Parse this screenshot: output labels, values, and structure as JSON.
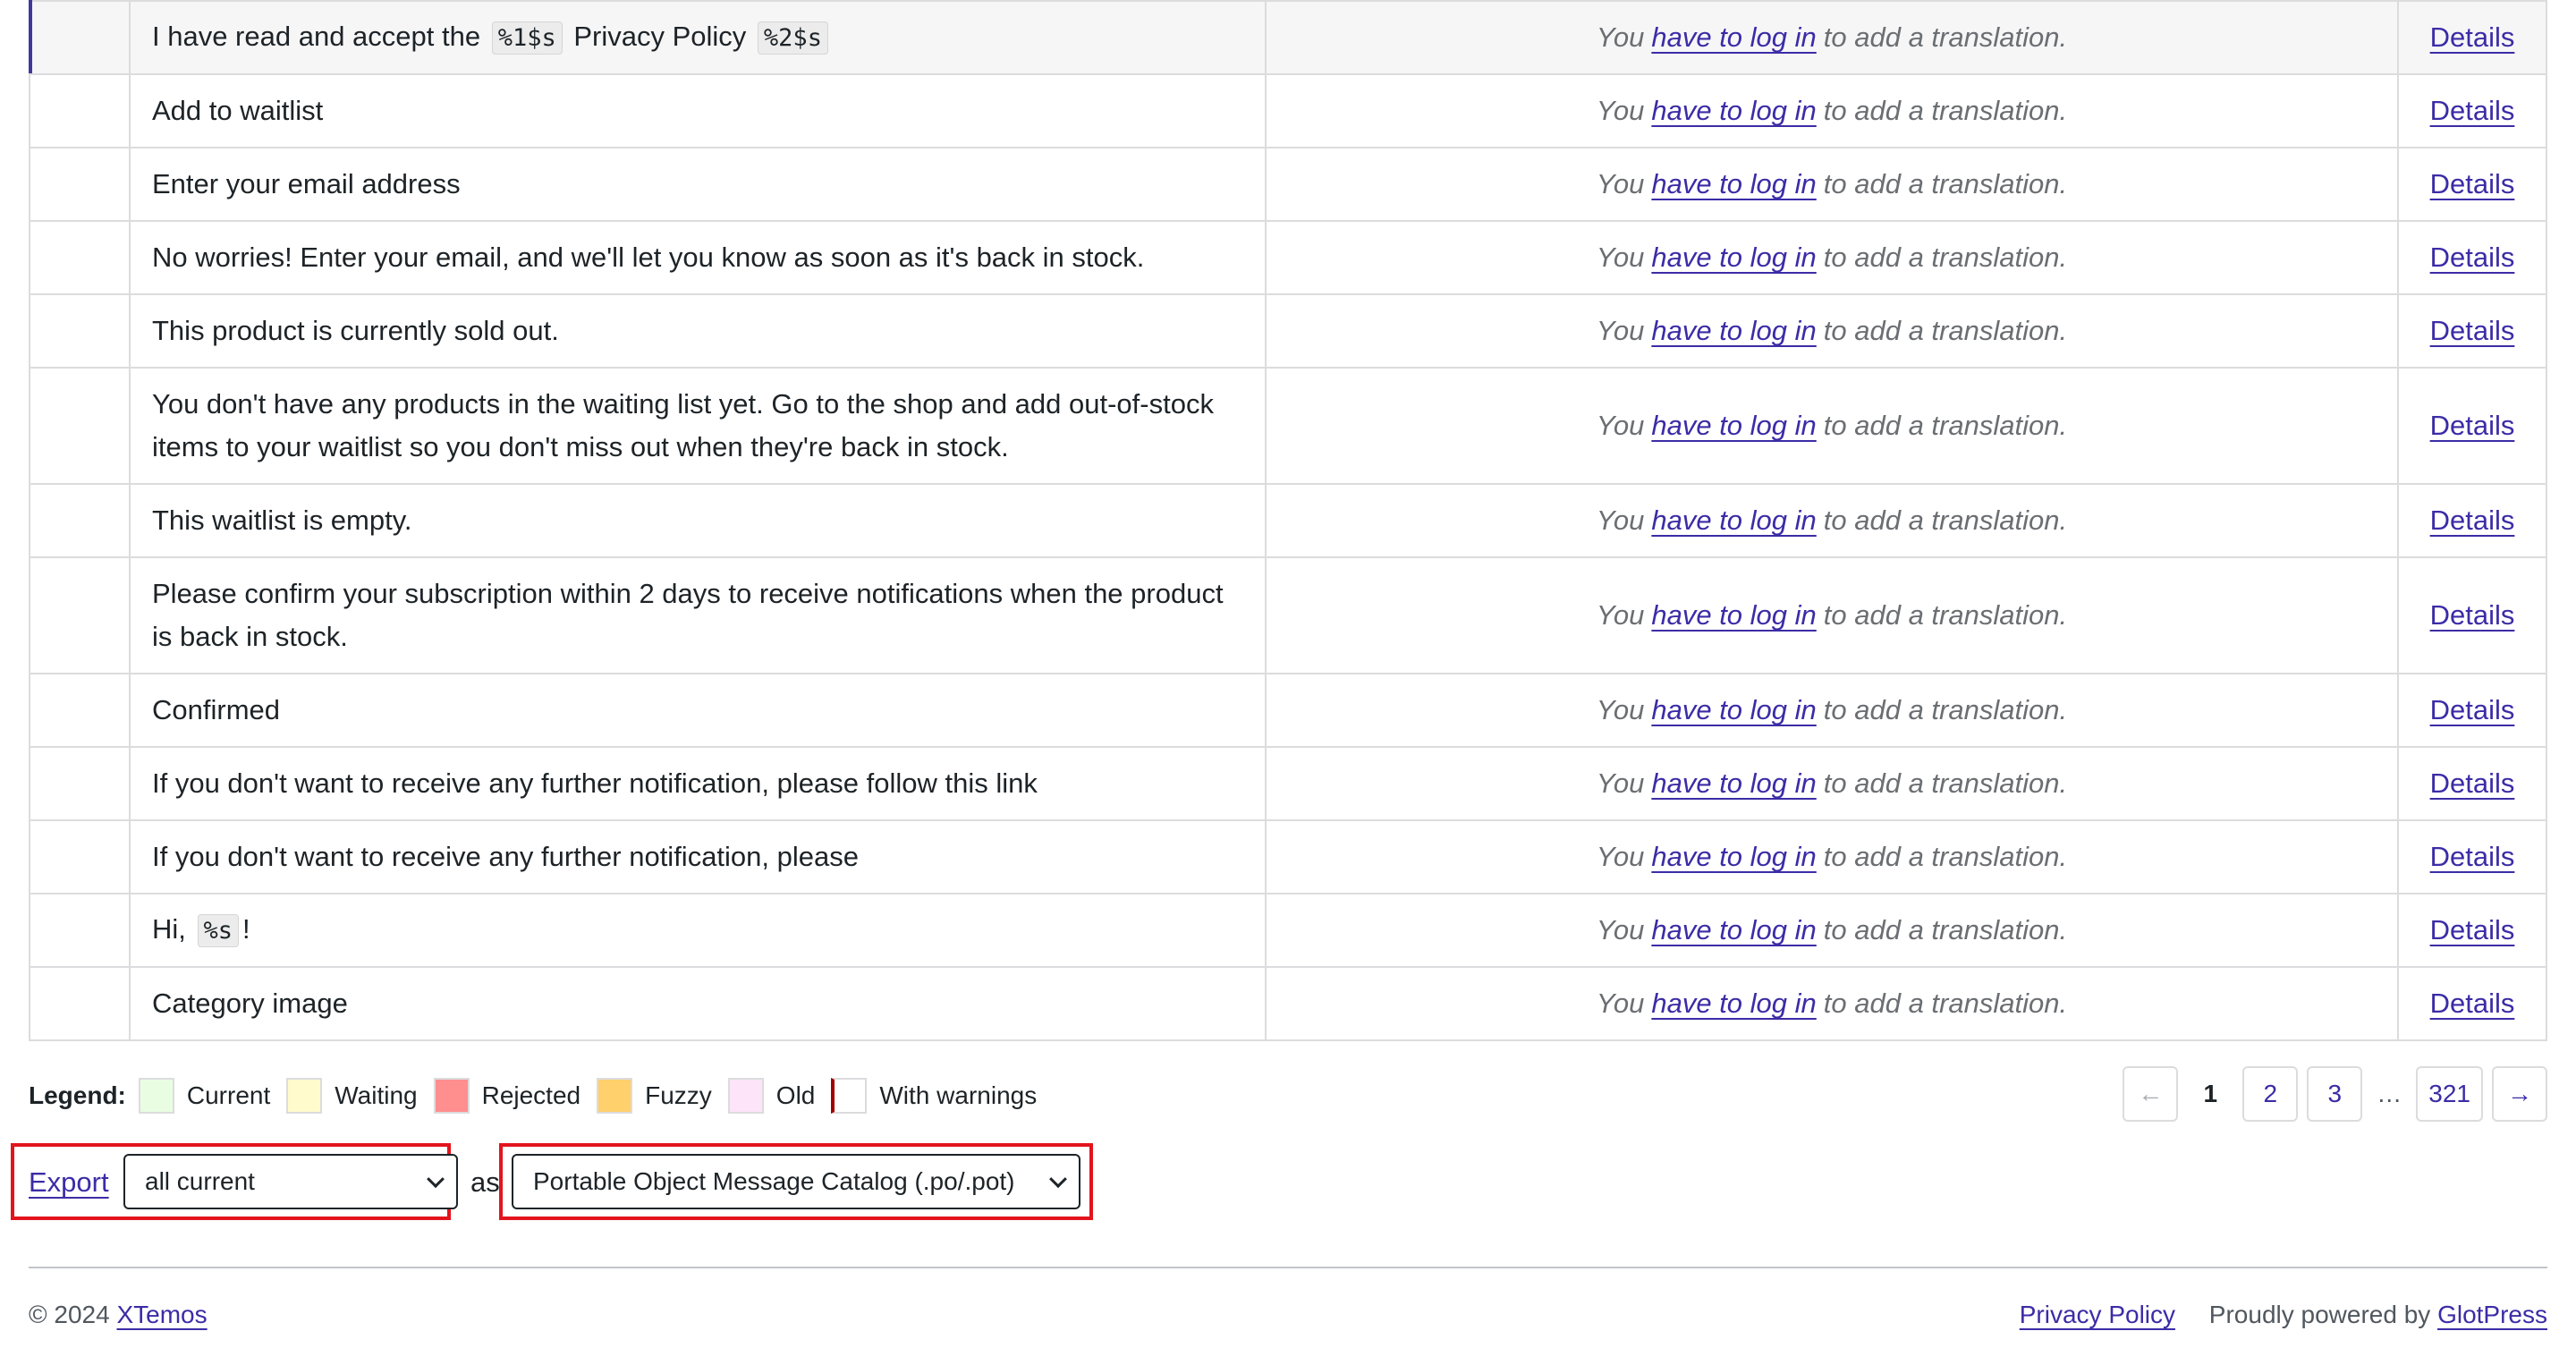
{
  "translation_cell": {
    "prefix": "You",
    "link": "have to log in",
    "suffix": "to add a translation."
  },
  "details_label": "Details",
  "rows": [
    {
      "parts": [
        {
          "t": "I have read and accept the "
        },
        {
          "c": "%1$s"
        },
        {
          "t": " Privacy Policy "
        },
        {
          "c": "%2$s"
        }
      ]
    },
    {
      "parts": [
        {
          "t": "Add to waitlist"
        }
      ]
    },
    {
      "parts": [
        {
          "t": "Enter your email address"
        }
      ]
    },
    {
      "parts": [
        {
          "t": "No worries! Enter your email, and we'll let you know as soon as it's back in stock."
        }
      ]
    },
    {
      "parts": [
        {
          "t": "This product is currently sold out."
        }
      ]
    },
    {
      "parts": [
        {
          "t": "You don't have any products in the waiting list yet. Go to the shop and add out-of-stock items to your waitlist so you don't miss out when they're back in stock."
        }
      ]
    },
    {
      "parts": [
        {
          "t": "This waitlist is empty."
        }
      ]
    },
    {
      "parts": [
        {
          "t": "Please confirm your subscription within 2 days to receive notifications when the product is back in stock."
        }
      ]
    },
    {
      "parts": [
        {
          "t": "Confirmed"
        }
      ]
    },
    {
      "parts": [
        {
          "t": "If you don't want to receive any further notification, please follow this link"
        }
      ]
    },
    {
      "parts": [
        {
          "t": "If you don't want to receive any further notification, please"
        }
      ]
    },
    {
      "parts": [
        {
          "t": "Hi, "
        },
        {
          "c": "%s"
        },
        {
          "t": "!"
        }
      ]
    },
    {
      "parts": [
        {
          "t": "Category image"
        }
      ]
    }
  ],
  "legend": {
    "label": "Legend:",
    "items": [
      {
        "name": "current",
        "label": "Current",
        "color": "#e9fde3"
      },
      {
        "name": "waiting",
        "label": "Waiting",
        "color": "#fffbcc"
      },
      {
        "name": "rejected",
        "label": "Rejected",
        "color": "#ff8e8e"
      },
      {
        "name": "fuzzy",
        "label": "Fuzzy",
        "color": "#ffd06b"
      },
      {
        "name": "old",
        "label": "Old",
        "color": "#fee4f8"
      },
      {
        "name": "warnings",
        "label": "With warnings",
        "color": "#ffffff",
        "warning": true
      }
    ]
  },
  "pagination": {
    "prev": "←",
    "current": "1",
    "pages": [
      "2",
      "3"
    ],
    "dots": "…",
    "last": "321",
    "next": "→"
  },
  "export": {
    "link": "Export",
    "what_value": "all current",
    "as_label": "as",
    "format_value": "Portable Object Message Catalog (.po/.pot)",
    "highlight_color": "#e3141d"
  },
  "footer": {
    "copyright": "© 2024",
    "company": "XTemos",
    "privacy": "Privacy Policy",
    "powered": "Proudly powered by",
    "powered_link": "GlotPress"
  }
}
